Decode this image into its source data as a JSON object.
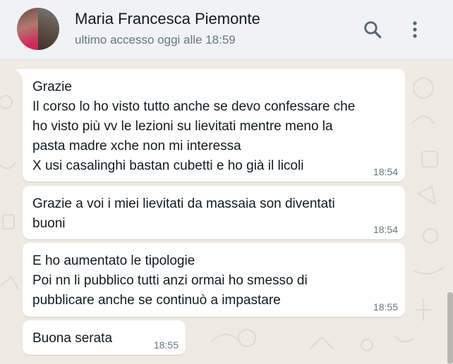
{
  "header": {
    "contact_name": "Maria Francesca Piemonte",
    "status": "ultimo accesso oggi alle 18:59"
  },
  "messages": [
    {
      "lines": [
        "Grazie",
        "Il corso lo ho visto tutto anche se devo confessare che",
        "ho visto più vv le lezioni su lievitati mentre meno la",
        "pasta madre xche non mi interessa",
        "X usi casalinghi bastan cubetti e ho già il licoli"
      ],
      "time": "18:54"
    },
    {
      "lines": [
        "Grazie a voi i miei lievitati da massaia son diventati",
        "buoni"
      ],
      "time": "18:54"
    },
    {
      "lines": [
        "E ho aumentato le tipologie",
        "Poi nn li pubblico tutti anzi ormai ho smesso di",
        "pubblicare anche se continuò a impastare"
      ],
      "time": "18:55"
    },
    {
      "lines": [
        "Buona serata"
      ],
      "time": "18:55"
    }
  ],
  "colors": {
    "header_bg": "#f0f2f5",
    "chat_bg": "#efeae2",
    "bubble_incoming": "#ffffff",
    "text": "#111b21",
    "meta_text": "#667781",
    "icon": "#54656f"
  },
  "icons": {
    "search": "search-icon",
    "menu": "kebab-menu-icon"
  }
}
